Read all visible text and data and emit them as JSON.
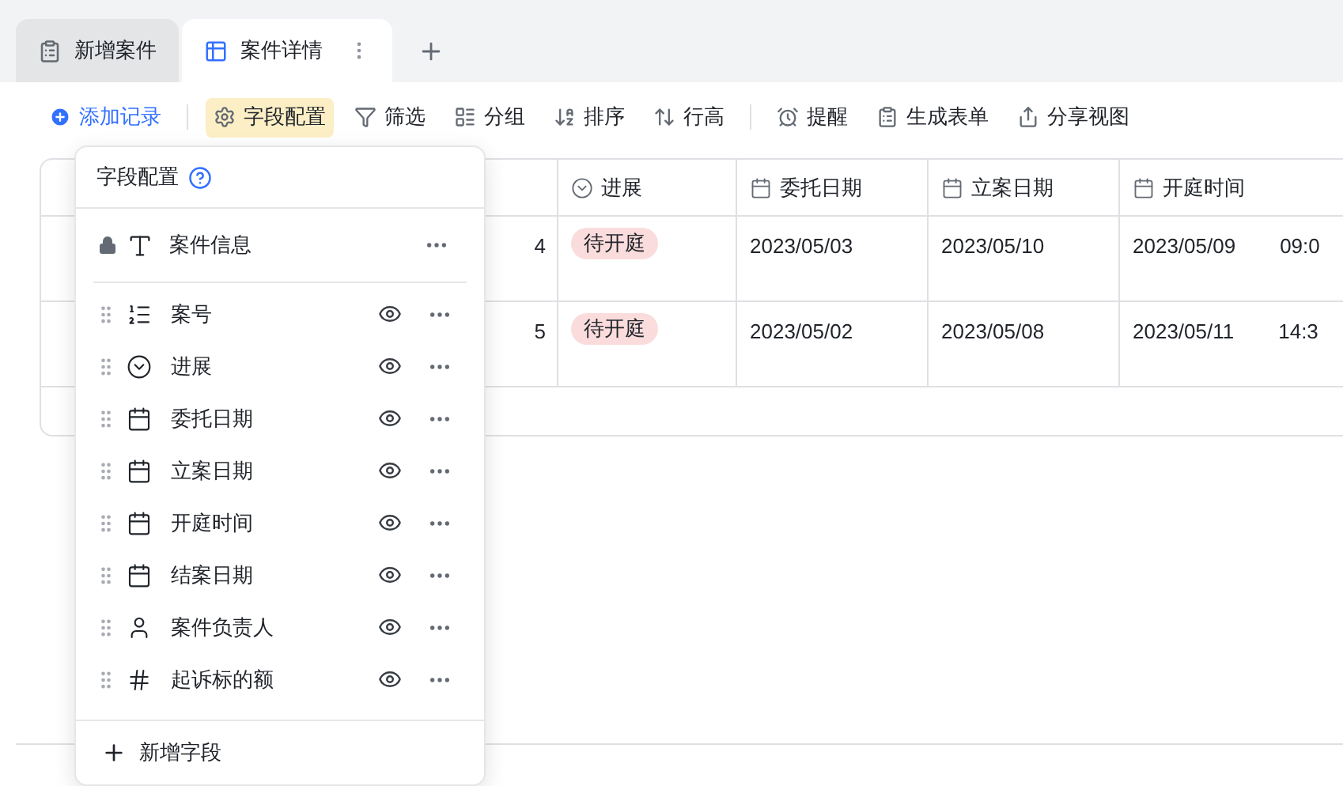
{
  "tabs": [
    {
      "label": "新增案件",
      "kind": "form",
      "selected": false
    },
    {
      "label": "案件详情",
      "kind": "table",
      "selected": true
    }
  ],
  "toolbar": [
    {
      "label": "添加记录",
      "kind": "add",
      "selected": false
    },
    {
      "label": "字段配置",
      "kind": "gear",
      "selected": true
    },
    {
      "label": "筛选",
      "kind": "filter",
      "selected": false
    },
    {
      "label": "分组",
      "kind": "group",
      "selected": false
    },
    {
      "label": "排序",
      "kind": "sort",
      "selected": false
    },
    {
      "label": "行高",
      "kind": "height",
      "selected": false
    },
    {
      "label": "提醒",
      "kind": "clock",
      "selected": false
    },
    {
      "label": "生成表单",
      "kind": "form",
      "selected": false
    },
    {
      "label": "分享视图",
      "kind": "share",
      "selected": false
    }
  ],
  "table": {
    "columns": [
      {
        "label": "进展",
        "kind": "select"
      },
      {
        "label": "委托日期",
        "kind": "date"
      },
      {
        "label": "立案日期",
        "kind": "date"
      },
      {
        "label": "开庭时间",
        "kind": "date"
      }
    ],
    "rows": [
      {
        "number": "4",
        "status": "待开庭",
        "entrust_date": "2023/05/03",
        "filing_date": "2023/05/10",
        "hearing_date": "2023/05/09",
        "hearing_time": "09:0"
      },
      {
        "number": "5",
        "status": "待开庭",
        "entrust_date": "2023/05/02",
        "filing_date": "2023/05/08",
        "hearing_date": "2023/05/11",
        "hearing_time": "14:3"
      }
    ]
  },
  "field_config": {
    "title": "字段配置",
    "primary_field": {
      "label": "案件信息",
      "kind": "text"
    },
    "fields": [
      {
        "label": "案号",
        "kind": "number",
        "visible": true
      },
      {
        "label": "进展",
        "kind": "select",
        "visible": true
      },
      {
        "label": "委托日期",
        "kind": "date",
        "visible": true
      },
      {
        "label": "立案日期",
        "kind": "date",
        "visible": true
      },
      {
        "label": "开庭时间",
        "kind": "date",
        "visible": true
      },
      {
        "label": "结案日期",
        "kind": "date",
        "visible": true
      },
      {
        "label": "案件负责人",
        "kind": "person",
        "visible": true
      },
      {
        "label": "起诉标的额",
        "kind": "currency",
        "visible": true
      }
    ],
    "add_button": "新增字段"
  }
}
